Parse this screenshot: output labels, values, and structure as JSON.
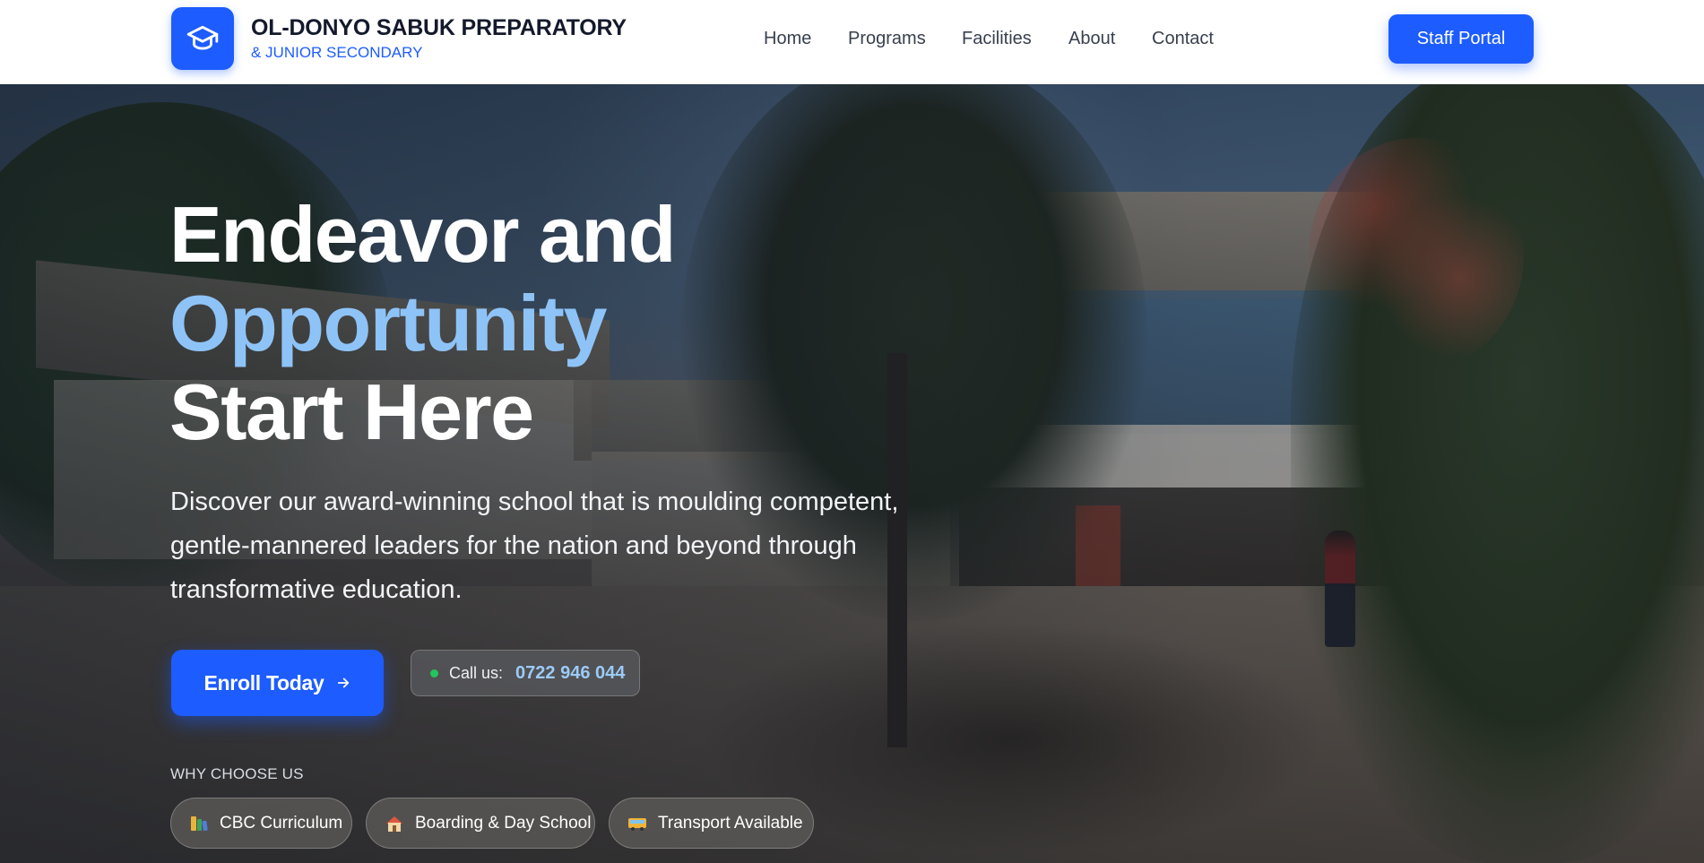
{
  "header": {
    "brand_name": "OL-DONYO SABUK PREPARATORY",
    "brand_sub": "& JUNIOR SECONDARY",
    "logo_icon": "graduation-cap-icon",
    "nav": [
      {
        "label": "Home"
      },
      {
        "label": "Programs"
      },
      {
        "label": "Facilities"
      },
      {
        "label": "About"
      },
      {
        "label": "Contact"
      }
    ],
    "staff_portal_label": "Staff Portal"
  },
  "hero": {
    "headline_line1": "Endeavor and",
    "headline_line2": "Opportunity",
    "headline_line3": "Start Here",
    "lead": "Discover our award-winning school that is moulding competent, gentle-mannered leaders for the nation and beyond through transformative education.",
    "enroll_label": "Enroll Today",
    "enroll_icon": "arrow-right-icon",
    "call_label": "Call us:",
    "call_number": "0722 946 044",
    "why_label": "WHY CHOOSE US",
    "features": [
      {
        "label": "CBC Curriculum",
        "icon": "books-icon"
      },
      {
        "label": "Boarding & Day School",
        "icon": "house-icon"
      },
      {
        "label": "Transport Available",
        "icon": "bus-icon"
      }
    ]
  },
  "colors": {
    "primary": "#1d5cff",
    "headline_accent": "#8ec3f7",
    "phone_accent": "#9ccbf7",
    "status_dot": "#22c55e",
    "text_dark": "#141a2b"
  }
}
